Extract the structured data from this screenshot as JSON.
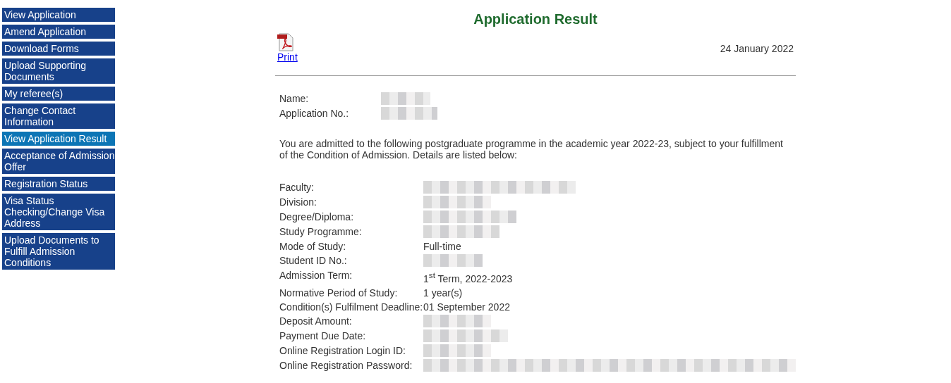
{
  "sidebar": {
    "items": [
      {
        "label": "View Application",
        "selected": false
      },
      {
        "label": "Amend Application",
        "selected": false
      },
      {
        "label": "Download Forms",
        "selected": false
      },
      {
        "label": "Upload Supporting Documents",
        "selected": false
      },
      {
        "label": "My referee(s)",
        "selected": false
      },
      {
        "label": "Change Contact Information",
        "selected": false
      },
      {
        "label": "View Application Result",
        "selected": true
      },
      {
        "label": "Acceptance of Admission Offer",
        "selected": false
      },
      {
        "label": "Registration Status",
        "selected": false
      },
      {
        "label": "Visa Status Checking/Change Visa Address",
        "selected": false
      },
      {
        "label": "Upload Documents to Fulfill Admission Conditions",
        "selected": false
      }
    ]
  },
  "page": {
    "title": "Application Result",
    "print_link": "Print",
    "date": "24 January 2022",
    "applicant": [
      {
        "label": "Name:",
        "redacted": true
      },
      {
        "label": "Application No.:",
        "redacted": true
      }
    ],
    "intro": "You are admitted to the following postgraduate programme in the academic year 2022-23, subject to your fulfillment of the Condition of Admission. Details are listed below:",
    "details": [
      {
        "label": "Faculty:",
        "redacted": true
      },
      {
        "label": "Division:",
        "redacted": true
      },
      {
        "label": "Degree/Diploma:",
        "redacted": true
      },
      {
        "label": "Study Programme:",
        "redacted": true
      },
      {
        "label": "Mode of Study:",
        "redacted": false,
        "value": "Full-time"
      },
      {
        "label": "Student ID No.:",
        "redacted": true
      },
      {
        "label": "Admission Term:",
        "redacted": false,
        "value": "1$^{st}$ Term, 2022-2023"
      },
      {
        "label": "Normative Period of Study:",
        "redacted": false,
        "value": "1 year(s)"
      },
      {
        "label": "Condition(s) Fulfilment Deadline:",
        "redacted": false,
        "value": "01 September 2022"
      },
      {
        "label": "Deposit Amount:",
        "redacted": true
      },
      {
        "label": "Payment Due Date:",
        "redacted": true
      },
      {
        "label": "Online Registration Login ID:",
        "redacted": true
      },
      {
        "label": "Online Registration Password:",
        "redacted": true
      }
    ]
  }
}
